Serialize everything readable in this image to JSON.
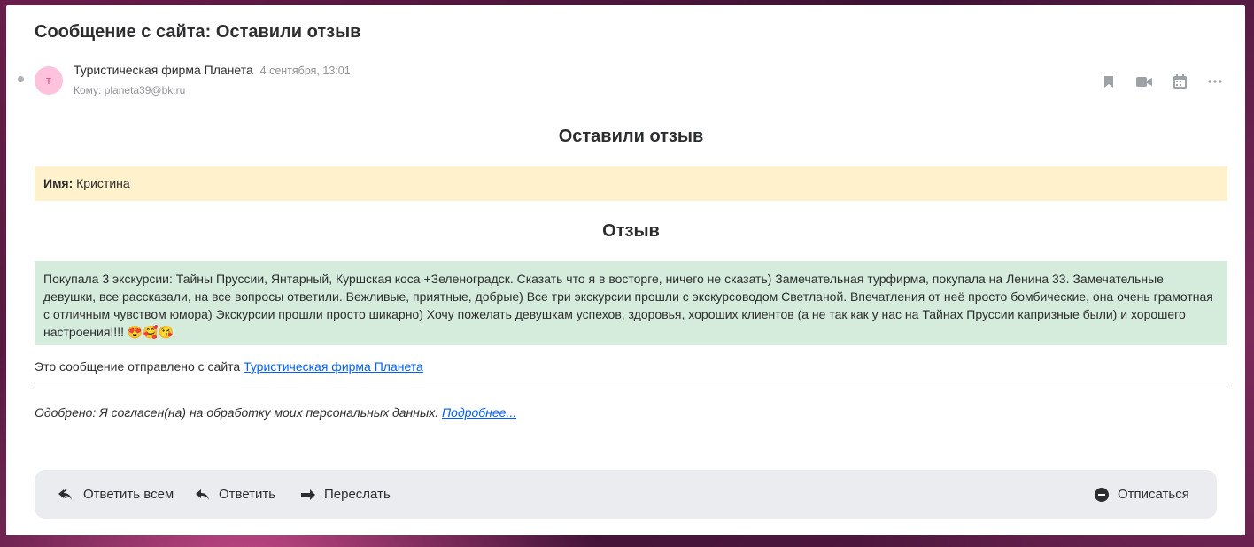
{
  "message": {
    "subject": "Сообщение с сайта: Оставили отзыв",
    "avatar_letter": "т",
    "sender": "Туристическая фирма Планета",
    "date": "4 сентября, 13:01",
    "to": "Кому: planeta39@bk.ru"
  },
  "toolbar": {
    "icons": [
      "bookmark-icon",
      "video-icon",
      "calendar-icon",
      "more-icon"
    ]
  },
  "body": {
    "heading": "Оставили отзыв",
    "name_label": "Имя:",
    "name_value": "Кристина",
    "review_heading": "Отзыв",
    "review_text": "Покупала 3 экскурсии: Тайны Пруссии, Янтарный, Куршская коса +Зеленоградск. Сказать что я в восторге, ничего не сказать) Замечательная турфирма, покупала на Ленина 33. Замечательные девушки, все рассказали, на все вопросы ответили. Вежливые, приятные, добрые) Все три экскурсии прошли с экскурсоводом Светланой. Впечатления от неё просто бомбические, она очень грамотная с отличным чувством юмора) Экскурсии прошли просто шикарно) Хочу пожелать девушкам успехов, здоровья, хороших клиентов (а не так как у нас на Тайнах Пруссии капризные были) и хорошего настроения!!!! 😍🥰😘",
    "sent_from_prefix": "Это сообщение отправлено с сайта ",
    "sent_from_link": "Туристическая фирма Планета",
    "consent_text": "Одобрено: Я согласен(на) на обработку моих персональных данных. ",
    "consent_link": "Подробнее..."
  },
  "actions": {
    "reply_all": "Ответить всем",
    "reply": "Ответить",
    "forward": "Переслать",
    "unsubscribe": "Отписаться"
  },
  "colors": {
    "name_bg": "#fff1cc",
    "review_bg": "#d5ebdb",
    "link": "#005ff9",
    "avatar_bg": "#ffc2dd"
  }
}
